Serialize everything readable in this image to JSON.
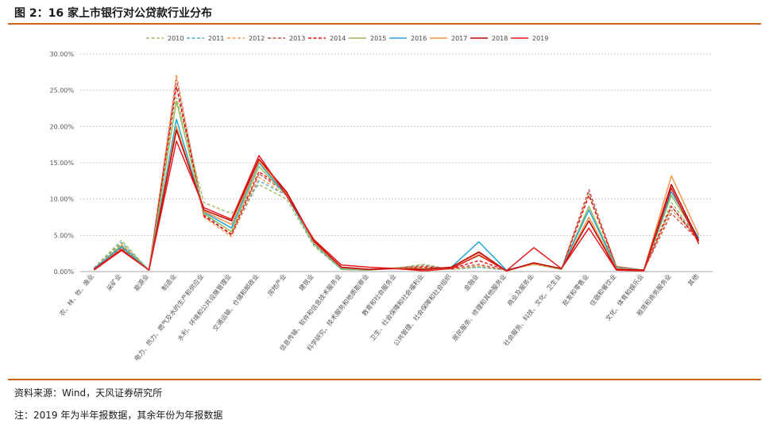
{
  "figure": {
    "title": "图 2：16 家上市银行对公贷款行业分布",
    "source": "资料来源：Wind，天风证券研究所",
    "footnote": "注：2019 年为半年报数据，其余年份为年报数据"
  },
  "chart_data": {
    "type": "line",
    "title": "",
    "xlabel": "",
    "ylabel": "",
    "ylim": [
      0,
      30
    ],
    "yticks": [
      "0.00%",
      "5.00%",
      "10.00%",
      "15.00%",
      "20.00%",
      "25.00%",
      "30.00%"
    ],
    "grid": "horizontal dotted",
    "legend": "top",
    "categories": [
      "农、林、牧、渔业",
      "采矿业",
      "能源业",
      "制造业",
      "电力、热力、燃气及水的生产和供应业",
      "水利、环境和公共设施管理业",
      "交通运输、仓储和邮政业",
      "房地产业",
      "建筑业",
      "信息传输、软件和信息技术服务业",
      "科学研究、技术服务和地质勘察业",
      "教育和社会服务业",
      "卫生、社会保障和社会福利业",
      "公共管理、社会保障和社会组织",
      "金融业",
      "居民服务、修理和其他服务业",
      "商业及服务业",
      "社会服务、科技、文化、卫生业",
      "批发和零售业",
      "住宿和餐饮业",
      "文化、体育和娱乐业",
      "租赁和商务服务业",
      "其他"
    ],
    "series": [
      {
        "name": "2010",
        "color": "#9bbb59",
        "dash": "dashed",
        "values": [
          0.5,
          4.3,
          0.2,
          24.0,
          9.5,
          8.0,
          12.0,
          10.0,
          3.5,
          0.3,
          0.2,
          0.5,
          1.0,
          0.3,
          0.6,
          0.2,
          1.0,
          0.3,
          10.5,
          0.5,
          0.2,
          9.5,
          4.5
        ]
      },
      {
        "name": "2011",
        "color": "#4bacc6",
        "dash": "dashed",
        "values": [
          0.5,
          4.0,
          0.2,
          25.5,
          8.0,
          5.0,
          12.5,
          10.5,
          3.7,
          0.3,
          0.2,
          0.5,
          0.9,
          0.3,
          0.6,
          0.2,
          1.0,
          0.3,
          10.8,
          0.5,
          0.2,
          9.0,
          4.5
        ]
      },
      {
        "name": "2012",
        "color": "#f79646",
        "dash": "dashed",
        "values": [
          0.5,
          3.8,
          0.2,
          27.2,
          7.5,
          4.8,
          13.0,
          10.5,
          3.8,
          0.3,
          0.2,
          0.5,
          0.8,
          0.3,
          0.8,
          0.2,
          1.0,
          0.3,
          11.0,
          0.6,
          0.2,
          8.5,
          4.5
        ]
      },
      {
        "name": "2013",
        "color": "#c0504d",
        "dash": "dashed",
        "values": [
          0.4,
          3.5,
          0.2,
          26.5,
          7.8,
          5.0,
          13.5,
          10.8,
          4.0,
          0.3,
          0.2,
          0.5,
          0.7,
          0.4,
          1.0,
          0.2,
          1.1,
          0.3,
          11.3,
          0.7,
          0.2,
          8.0,
          4.3
        ]
      },
      {
        "name": "2014",
        "color": "#ff0000",
        "dash": "dashed",
        "values": [
          0.4,
          3.3,
          0.2,
          25.5,
          7.6,
          5.2,
          13.8,
          11.0,
          4.1,
          0.3,
          0.2,
          0.5,
          0.6,
          0.4,
          1.5,
          0.2,
          1.1,
          0.3,
          10.5,
          0.7,
          0.2,
          9.0,
          4.2
        ]
      },
      {
        "name": "2015",
        "color": "#9bbb59",
        "dash": "solid",
        "values": [
          0.4,
          3.6,
          0.2,
          23.5,
          8.0,
          5.5,
          14.5,
          10.5,
          3.9,
          0.3,
          0.2,
          0.5,
          0.4,
          0.5,
          2.2,
          0.2,
          1.1,
          0.3,
          9.0,
          0.6,
          0.2,
          10.5,
          4.5
        ]
      },
      {
        "name": "2016",
        "color": "#23a6d8",
        "dash": "solid",
        "values": [
          0.4,
          3.4,
          0.2,
          21.0,
          8.2,
          6.0,
          15.0,
          10.5,
          3.9,
          0.4,
          0.3,
          0.4,
          0.3,
          0.6,
          4.1,
          0.2,
          1.1,
          0.4,
          8.5,
          0.5,
          0.2,
          11.0,
          4.6
        ]
      },
      {
        "name": "2017",
        "color": "#f79646",
        "dash": "solid",
        "values": [
          0.3,
          3.1,
          0.2,
          20.0,
          8.3,
          6.5,
          15.2,
          10.8,
          4.0,
          0.5,
          0.3,
          0.4,
          0.3,
          0.6,
          2.6,
          0.1,
          1.1,
          0.4,
          7.5,
          0.4,
          0.2,
          13.2,
          5.0
        ]
      },
      {
        "name": "2018",
        "color": "#c00000",
        "dash": "solid",
        "values": [
          0.3,
          3.0,
          0.2,
          19.5,
          8.5,
          7.0,
          15.5,
          11.0,
          4.2,
          0.6,
          0.3,
          0.4,
          0.3,
          0.6,
          2.7,
          0.1,
          1.2,
          0.4,
          7.0,
          0.3,
          0.2,
          12.0,
          4.2
        ]
      },
      {
        "name": "2019",
        "color": "#e8191c",
        "dash": "solid",
        "values": [
          0.2,
          2.9,
          0.2,
          18.0,
          8.8,
          7.2,
          16.0,
          10.5,
          4.4,
          0.9,
          0.6,
          0.4,
          0.1,
          0.4,
          2.3,
          0.1,
          3.3,
          0.4,
          6.0,
          0.2,
          0.1,
          11.5,
          3.8
        ]
      }
    ]
  }
}
